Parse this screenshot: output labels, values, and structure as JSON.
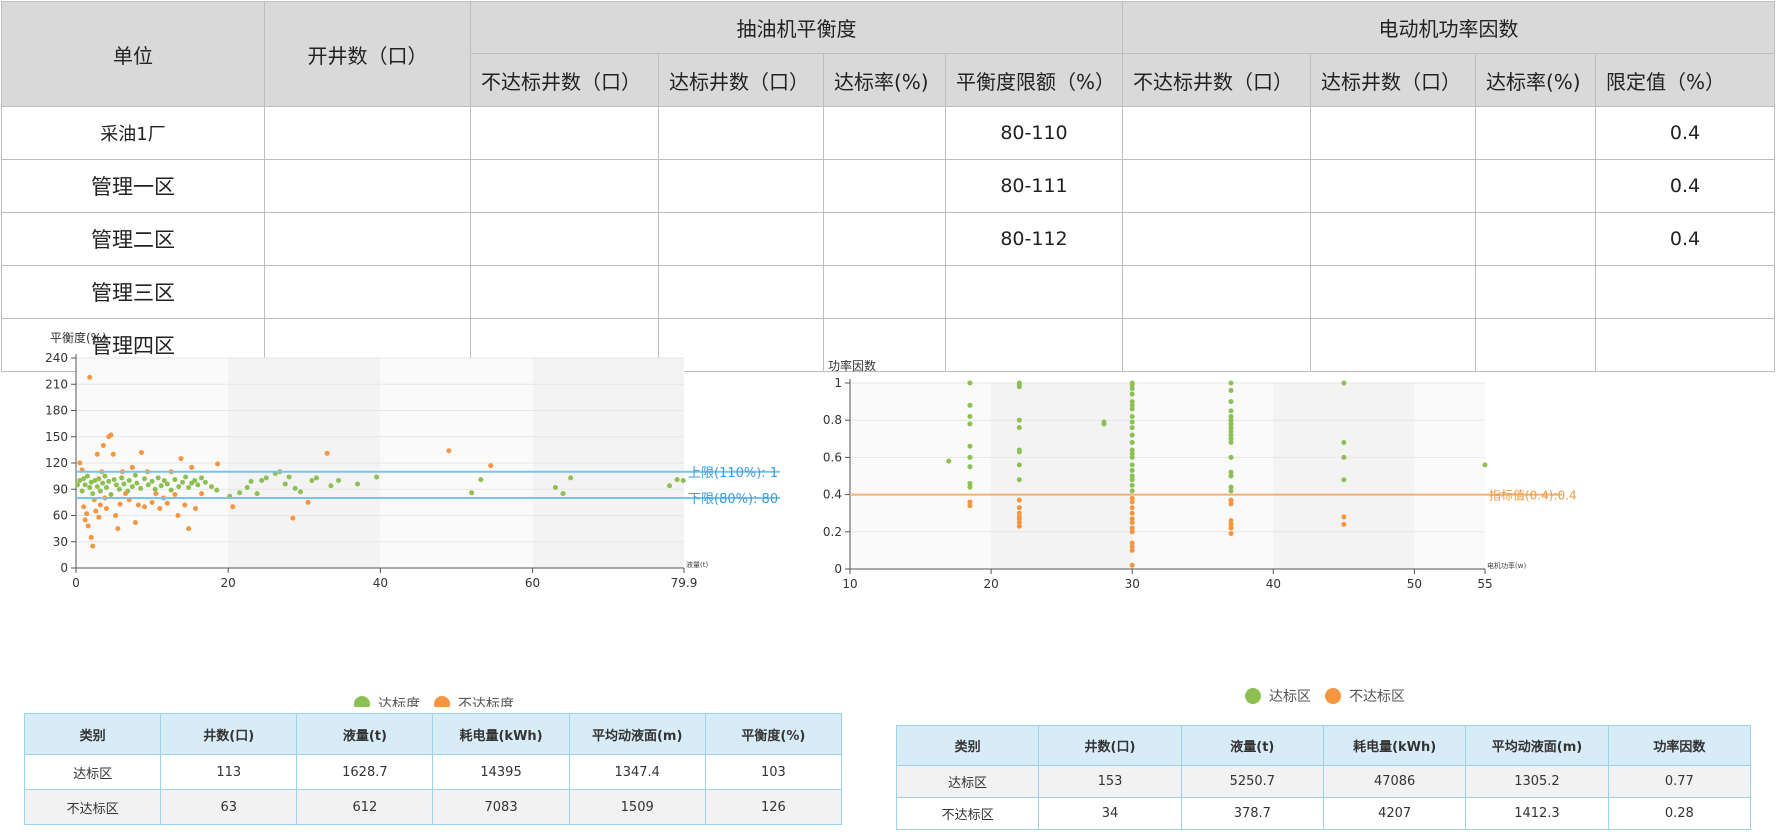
{
  "top_table": {
    "headers": {
      "unit": "单位",
      "open_wells": "开井数（口）",
      "balance_group": "抽油机平衡度",
      "power_group": "电动机功率因数",
      "balance_cols": [
        "不达标井数（口）",
        "达标井数（口）",
        "达标率(%)",
        "平衡度限额（%）"
      ],
      "power_cols": [
        "不达标井数（口）",
        "达标井数（口）",
        "达标率(%)",
        "限定值（%）"
      ]
    },
    "rows": [
      {
        "unit": "采油1厂",
        "balance_limit": "80-110",
        "power_limit": "0.4"
      },
      {
        "unit": "管理一区",
        "balance_limit": "80-111",
        "power_limit": "0.4"
      },
      {
        "unit": "管理二区",
        "balance_limit": "80-112",
        "power_limit": "0.4"
      },
      {
        "unit": "管理三区",
        "balance_limit": "",
        "power_limit": ""
      },
      {
        "unit": "管理四区",
        "balance_limit": "",
        "power_limit": ""
      }
    ]
  },
  "chart_data": [
    {
      "type": "scatter",
      "ylabel": "平衡度(%)",
      "xlabel": "液量(t)",
      "xlim": [
        0,
        79.9
      ],
      "ylim": [
        0,
        240
      ],
      "x_ticks": [
        "0",
        "20",
        "40",
        "60",
        "79.9"
      ],
      "y_ticks": [
        "0",
        "30",
        "60",
        "90",
        "120",
        "150",
        "180",
        "210",
        "240"
      ],
      "upper_line": {
        "value": 110,
        "label": "上限(110%): 1"
      },
      "lower_line": {
        "value": 80,
        "label": "下限(80%): 80"
      },
      "legend": [
        "达标度",
        "不达标度"
      ],
      "colors": {
        "ok": "#8dc052",
        "bad": "#f5963f",
        "line": "#7cc3ea"
      },
      "series": [
        {
          "name": "达标度",
          "points": [
            [
              0.2,
              95
            ],
            [
              0.5,
              100
            ],
            [
              0.8,
              88
            ],
            [
              1,
              102
            ],
            [
              1.2,
              95
            ],
            [
              1.5,
              105
            ],
            [
              1.8,
              92
            ],
            [
              2,
              98
            ],
            [
              2.2,
              85
            ],
            [
              2.5,
              100
            ],
            [
              2.8,
              93
            ],
            [
              3,
              102
            ],
            [
              3.2,
              88
            ],
            [
              3.5,
              97
            ],
            [
              3.8,
              105
            ],
            [
              4,
              92
            ],
            [
              4.3,
              99
            ],
            [
              4.6,
              84
            ],
            [
              5,
              101
            ],
            [
              5.3,
              95
            ],
            [
              5.7,
              90
            ],
            [
              6,
              103
            ],
            [
              6.3,
              96
            ],
            [
              6.8,
              88
            ],
            [
              7,
              100
            ],
            [
              7.4,
              93
            ],
            [
              7.8,
              106
            ],
            [
              8,
              97
            ],
            [
              8.5,
              91
            ],
            [
              9,
              102
            ],
            [
              9.5,
              95
            ],
            [
              10,
              99
            ],
            [
              10.4,
              90
            ],
            [
              10.8,
              103
            ],
            [
              11.2,
              94
            ],
            [
              11.6,
              100
            ],
            [
              12,
              96
            ],
            [
              12.5,
              89
            ],
            [
              13,
              101
            ],
            [
              13.5,
              93
            ],
            [
              14,
              98
            ],
            [
              14.4,
              104
            ],
            [
              14.8,
              92
            ],
            [
              15.2,
              97
            ],
            [
              15.6,
              100
            ],
            [
              16,
              95
            ],
            [
              16.5,
              103
            ],
            [
              17,
              98
            ],
            [
              17.8,
              93
            ],
            [
              18.5,
              89
            ],
            [
              20.2,
              82
            ],
            [
              21.5,
              86
            ],
            [
              22.5,
              92
            ],
            [
              23,
              99
            ],
            [
              23.8,
              85
            ],
            [
              24.4,
              100
            ],
            [
              25,
              103
            ],
            [
              26.2,
              108
            ],
            [
              26.8,
              110
            ],
            [
              27.5,
              96
            ],
            [
              28,
              104
            ],
            [
              28.8,
              91
            ],
            [
              29.5,
              87
            ],
            [
              31,
              100
            ],
            [
              31.6,
              103
            ],
            [
              33.5,
              94
            ],
            [
              34.5,
              100
            ],
            [
              37,
              96
            ],
            [
              39.5,
              104
            ],
            [
              52,
              86
            ],
            [
              53.2,
              101
            ],
            [
              63,
              92
            ],
            [
              64,
              85
            ],
            [
              65,
              103
            ],
            [
              78,
              94
            ],
            [
              79,
              101
            ],
            [
              79.8,
              100
            ]
          ]
        },
        {
          "name": "不达标度",
          "points": [
            [
              0.5,
              120
            ],
            [
              0.8,
              112
            ],
            [
              1,
              70
            ],
            [
              1.2,
              55
            ],
            [
              1.4,
              62
            ],
            [
              1.6,
              48
            ],
            [
              1.8,
              218
            ],
            [
              2,
              35
            ],
            [
              2.2,
              25
            ],
            [
              2.4,
              78
            ],
            [
              2.6,
              65
            ],
            [
              2.8,
              130
            ],
            [
              3,
              58
            ],
            [
              3.2,
              72
            ],
            [
              3.4,
              110
            ],
            [
              3.6,
              140
            ],
            [
              3.8,
              80
            ],
            [
              4,
              68
            ],
            [
              4.3,
              150
            ],
            [
              4.6,
              152
            ],
            [
              4.9,
              130
            ],
            [
              5.2,
              60
            ],
            [
              5.5,
              45
            ],
            [
              5.8,
              73
            ],
            [
              6.1,
              110
            ],
            [
              6.5,
              85
            ],
            [
              7,
              78
            ],
            [
              7.4,
              115
            ],
            [
              7.8,
              52
            ],
            [
              8.2,
              72
            ],
            [
              8.6,
              132
            ],
            [
              9,
              70
            ],
            [
              9.4,
              110
            ],
            [
              10,
              75
            ],
            [
              10.5,
              85
            ],
            [
              11,
              68
            ],
            [
              11.5,
              80
            ],
            [
              12,
              74
            ],
            [
              12.5,
              110
            ],
            [
              13,
              84
            ],
            [
              13.4,
              60
            ],
            [
              13.8,
              125
            ],
            [
              14.3,
              72
            ],
            [
              14.8,
              45
            ],
            [
              15.2,
              115
            ],
            [
              15.7,
              68
            ],
            [
              16.5,
              85
            ],
            [
              18.6,
              119
            ],
            [
              20.6,
              70
            ],
            [
              28.5,
              57
            ],
            [
              30.5,
              75
            ],
            [
              33,
              131
            ],
            [
              49,
              134
            ],
            [
              54.5,
              117
            ]
          ]
        }
      ]
    },
    {
      "type": "scatter",
      "ylabel": "功率因数",
      "xlabel": "电机功率(w)",
      "xlim": [
        10,
        55
      ],
      "ylim": [
        0,
        1
      ],
      "x_ticks": [
        "10",
        "20",
        "30",
        "40",
        "50",
        "55"
      ],
      "y_ticks": [
        "0",
        "0.2",
        "0.4",
        "0.6",
        "0.8",
        "1"
      ],
      "threshold_line": {
        "value": 0.4,
        "label": "指标值(0.4):0.4"
      },
      "legend": [
        "达标区",
        "不达标区"
      ],
      "colors": {
        "ok": "#8dc052",
        "bad": "#f5963f",
        "line": "#f3b26e"
      },
      "series": [
        {
          "name": "达标区",
          "points": [
            [
              17,
              0.58
            ],
            [
              18.5,
              1
            ],
            [
              18.5,
              0.88
            ],
            [
              18.5,
              0.82
            ],
            [
              18.5,
              0.78
            ],
            [
              18.5,
              0.66
            ],
            [
              18.5,
              0.6
            ],
            [
              18.5,
              0.55
            ],
            [
              18.5,
              0.46
            ],
            [
              18.5,
              0.44
            ],
            [
              22,
              1
            ],
            [
              22,
              0.99
            ],
            [
              22,
              0.98
            ],
            [
              22,
              0.8
            ],
            [
              22,
              0.76
            ],
            [
              22,
              0.64
            ],
            [
              22,
              0.63
            ],
            [
              22,
              0.56
            ],
            [
              22,
              0.48
            ],
            [
              28,
              0.79
            ],
            [
              28,
              0.78
            ],
            [
              30,
              1
            ],
            [
              30,
              0.99
            ],
            [
              30,
              0.97
            ],
            [
              30,
              0.94
            ],
            [
              30,
              0.9
            ],
            [
              30,
              0.88
            ],
            [
              30,
              0.86
            ],
            [
              30,
              0.82
            ],
            [
              30,
              0.79
            ],
            [
              30,
              0.76
            ],
            [
              30,
              0.72
            ],
            [
              30,
              0.68
            ],
            [
              30,
              0.64
            ],
            [
              30,
              0.62
            ],
            [
              30,
              0.6
            ],
            [
              30,
              0.56
            ],
            [
              30,
              0.53
            ],
            [
              30,
              0.5
            ],
            [
              30,
              0.48
            ],
            [
              30,
              0.45
            ],
            [
              30,
              0.42
            ],
            [
              37,
              1
            ],
            [
              37,
              0.96
            ],
            [
              37,
              0.9
            ],
            [
              37,
              0.85
            ],
            [
              37,
              0.82
            ],
            [
              37,
              0.8
            ],
            [
              37,
              0.78
            ],
            [
              37,
              0.76
            ],
            [
              37,
              0.74
            ],
            [
              37,
              0.72
            ],
            [
              37,
              0.7
            ],
            [
              37,
              0.68
            ],
            [
              37,
              0.6
            ],
            [
              37,
              0.52
            ],
            [
              37,
              0.5
            ],
            [
              37,
              0.44
            ],
            [
              37,
              0.42
            ],
            [
              45,
              1
            ],
            [
              45,
              0.68
            ],
            [
              45,
              0.6
            ],
            [
              45,
              0.48
            ],
            [
              55,
              0.56
            ]
          ]
        },
        {
          "name": "不达标区",
          "points": [
            [
              18.5,
              0.36
            ],
            [
              18.5,
              0.34
            ],
            [
              22,
              0.37
            ],
            [
              22,
              0.33
            ],
            [
              22,
              0.3
            ],
            [
              22,
              0.28
            ],
            [
              22,
              0.27
            ],
            [
              22,
              0.25
            ],
            [
              22,
              0.23
            ],
            [
              30,
              0.38
            ],
            [
              30,
              0.36
            ],
            [
              30,
              0.33
            ],
            [
              30,
              0.3
            ],
            [
              30,
              0.27
            ],
            [
              30,
              0.25
            ],
            [
              30,
              0.22
            ],
            [
              30,
              0.2
            ],
            [
              30,
              0.14
            ],
            [
              30,
              0.12
            ],
            [
              30,
              0.1
            ],
            [
              30,
              0.02
            ],
            [
              37,
              0.37
            ],
            [
              37,
              0.35
            ],
            [
              37,
              0.26
            ],
            [
              37,
              0.24
            ],
            [
              37,
              0.22
            ],
            [
              37,
              0.19
            ],
            [
              45,
              0.28
            ],
            [
              45,
              0.24
            ]
          ]
        }
      ]
    }
  ],
  "left_summary": {
    "headers": [
      "类别",
      "井数(口)",
      "液量(t)",
      "耗电量(kWh)",
      "平均动液面(m)",
      "平衡度(%)"
    ],
    "rows": [
      [
        "达标区",
        "113",
        "1628.7",
        "14395",
        "1347.4",
        "103"
      ],
      [
        "不达标区",
        "63",
        "612",
        "7083",
        "1509",
        "126"
      ]
    ]
  },
  "right_summary": {
    "headers": [
      "类别",
      "井数(口)",
      "液量(t)",
      "耗电量(kWh)",
      "平均动液面(m)",
      "功率因数"
    ],
    "rows": [
      [
        "达标区",
        "153",
        "5250.7",
        "47086",
        "1305.2",
        "0.77"
      ],
      [
        "不达标区",
        "34",
        "378.7",
        "4207",
        "1412.3",
        "0.28"
      ]
    ]
  }
}
